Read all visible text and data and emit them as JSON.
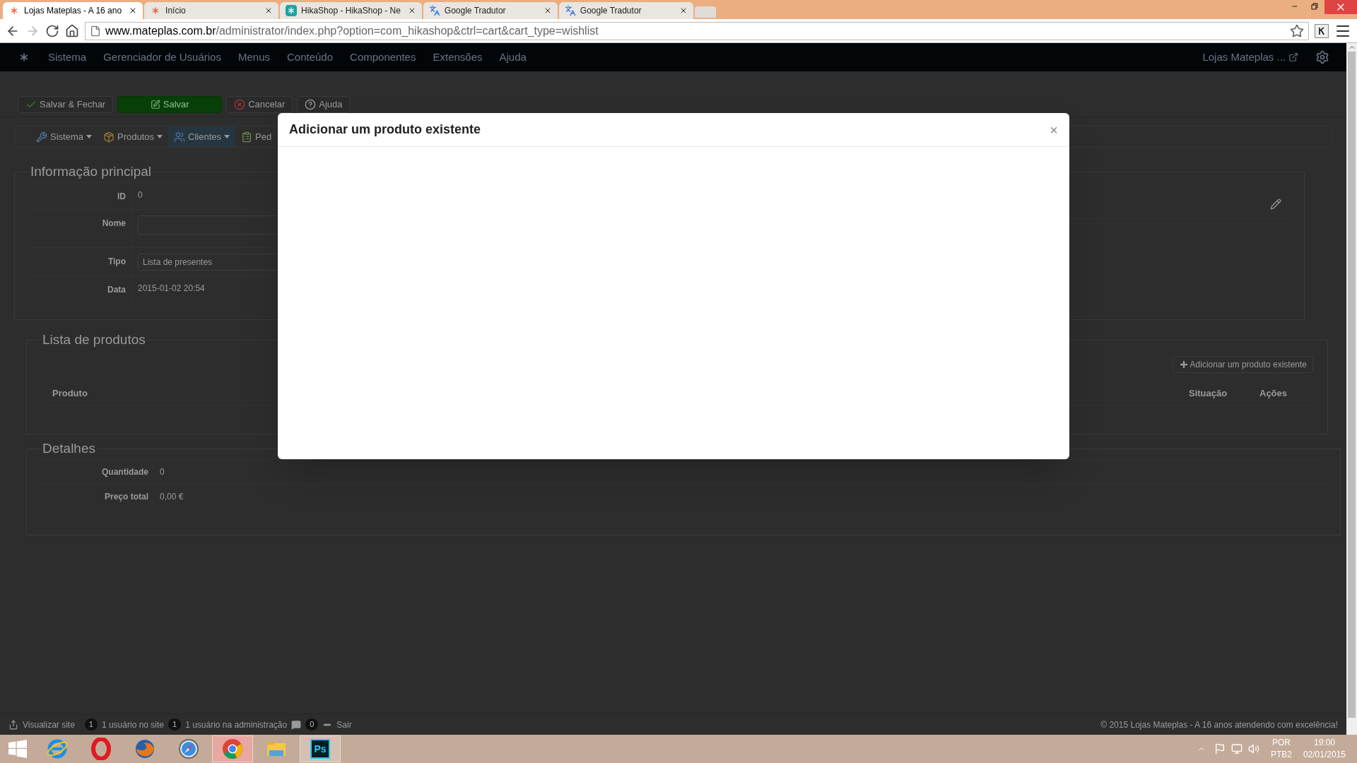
{
  "browser": {
    "tabs": [
      {
        "title": "Lojas Mateplas - A 16 ano",
        "selected": true
      },
      {
        "title": "Início",
        "selected": false
      },
      {
        "title": "HikaShop - HikaShop - Ne",
        "selected": false
      },
      {
        "title": "Google Tradutor",
        "selected": false
      },
      {
        "title": "Google Tradutor",
        "selected": false
      }
    ],
    "url": {
      "domain": "www.mateplas.com.br",
      "path": "/administrator/index.php?option=com_hikashop&ctrl=cart&cart_type=wishlist"
    }
  },
  "admin_menu": {
    "items": [
      "Sistema",
      "Gerenciador de Usuários",
      "Menus",
      "Conteúdo",
      "Componentes",
      "Extensões",
      "Ajuda"
    ],
    "site_name": "Lojas Mateplas ..."
  },
  "toolbar": [
    {
      "label": "Salvar & Fechar",
      "kind": "save-close"
    },
    {
      "label": "Salvar",
      "kind": "save"
    },
    {
      "label": "Cancelar",
      "kind": "cancel"
    },
    {
      "label": "Ajuda",
      "kind": "help"
    }
  ],
  "submenu": [
    {
      "label": "Sistema",
      "selected": false
    },
    {
      "label": "Produtos",
      "selected": false
    },
    {
      "label": "Clientes",
      "selected": true
    },
    {
      "label": "Ped",
      "selected": false
    }
  ],
  "main_info": {
    "title": "Informação principal",
    "fields": [
      {
        "label": "ID",
        "kind": "text",
        "value": "0"
      },
      {
        "label": "Nome",
        "kind": "input"
      },
      {
        "label": "Tipo",
        "kind": "select",
        "value": "Lista de presentes"
      },
      {
        "label": "Data",
        "kind": "text",
        "value": "2015-01-02 20:54"
      }
    ]
  },
  "products": {
    "title": "Lista de produtos",
    "add_button": "Adicionar um produto existente",
    "columns": [
      "Produto",
      "Situação",
      "Ações"
    ]
  },
  "details": {
    "title": "Detalhes",
    "rows": [
      {
        "label": "Quantidade",
        "value": "0"
      },
      {
        "label": "Preço total",
        "value": "0,00 €"
      }
    ]
  },
  "status_bar": {
    "view_site": "Visualizar site",
    "site_users": {
      "count": "1",
      "label": "1 usuário no site"
    },
    "admin_users": {
      "count": "1",
      "label": "1 usuário na administração"
    },
    "messages": "0",
    "logout": "Sair",
    "copyright": "© 2015 Lojas Mateplas - A 16 anos atendendo com excelência!"
  },
  "modal": {
    "title": "Adicionar um produto existente",
    "close": "×"
  },
  "taskbar": {
    "apps": [
      {
        "kind": "ie",
        "selected": false
      },
      {
        "kind": "opera",
        "selected": false
      },
      {
        "kind": "firefox",
        "selected": false
      },
      {
        "kind": "safari",
        "selected": false
      },
      {
        "kind": "chrome",
        "selected": true
      },
      {
        "kind": "explorer",
        "selected": false
      },
      {
        "kind": "photoshop",
        "selected": false,
        "label": "Ps"
      }
    ],
    "language": "POR",
    "layout": "PTB2",
    "time": "19:00",
    "date": "02/01/2015"
  }
}
